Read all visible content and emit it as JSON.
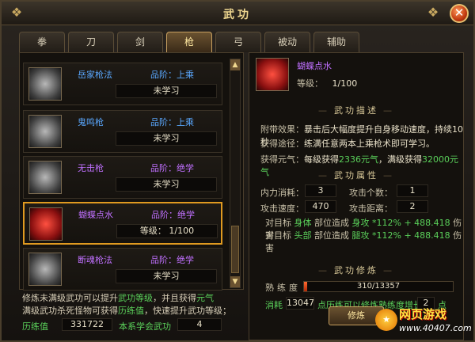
{
  "window": {
    "title": "武功"
  },
  "tabs": [
    "拳",
    "刀",
    "剑",
    "枪",
    "弓",
    "被动",
    "辅助"
  ],
  "active_tab": "枪",
  "skills": [
    {
      "name": "岳家枪法",
      "grade": "品阶：上乘",
      "status": "未学习"
    },
    {
      "name": "鬼鸣枪",
      "grade": "品阶：上乘",
      "status": "未学习"
    },
    {
      "name": "无击枪",
      "grade": "品阶：绝学",
      "status": "未学习"
    },
    {
      "name": "蝴蝶点水",
      "grade": "品阶：绝学",
      "status": "等级：    1/100"
    },
    {
      "name": "断魂枪法",
      "grade": "品阶：绝学",
      "status": "未学习"
    }
  ],
  "info": {
    "line1_a": "修炼未满级武功可以提升",
    "line1_b": "武功等级",
    "line1_c": "，并且获得",
    "line1_d": "元气",
    "line2_a": "满级武功杀死怪物可获得",
    "line2_b": "历练值",
    "line2_c": "，快速提升武功等级；",
    "exp_label": "历练值",
    "exp_value": "331722",
    "learned_label": "本系学会武功",
    "learned_value": "4"
  },
  "detail": {
    "name": "蝴蝶点水",
    "level_label": "等级：",
    "level_value": "1/100",
    "desc_title": "武功描述",
    "effect_label": "附带效果：",
    "effect_value": "暴击后大幅度提升自身移动速度，持续10秒",
    "path_label": "获得途径：",
    "path_value": "练满任意两本上乘枪术即可学习。",
    "yuanqi_label": "获得元气：",
    "yuanqi_a": "每级获得",
    "yuanqi_b": "2336元气",
    "yuanqi_c": "，满级获得",
    "yuanqi_d": "32000元气",
    "attr_title": "武功属性",
    "neili_label": "内力消耗：",
    "neili_value": "3",
    "targets_label": "攻击个数：",
    "targets_value": "1",
    "speed_label": "攻击速度：",
    "speed_value": "470",
    "range_label": "攻击距离：",
    "range_value": "2",
    "dmg1_a": "对目标",
    "dmg1_b": "身体",
    "dmg1_c": "部位造成",
    "dmg1_d": "身攻",
    "dmg1_e": "*112%",
    "dmg1_f": "+ 488.418",
    "dmg1_g": "伤害",
    "dmg2_a": "对目标",
    "dmg2_b": "头部",
    "dmg2_c": "部位造成",
    "dmg2_d": "腿攻",
    "dmg2_e": "*112%",
    "dmg2_f": "+ 488.418",
    "dmg2_g": "伤害",
    "train_title": "武功修炼",
    "prof_label": "熟练度",
    "prof_value": "310/13357",
    "prof_fraction": 0.023,
    "cost_label": "消耗",
    "cost_value": "13047",
    "cost_desc": "点历练可以修炼熟练度增长",
    "cost_gain": "2",
    "cost_unit": "点",
    "train_button": "修炼"
  },
  "watermark": {
    "line1": "网页游戏",
    "line2": "www.40407.com"
  }
}
